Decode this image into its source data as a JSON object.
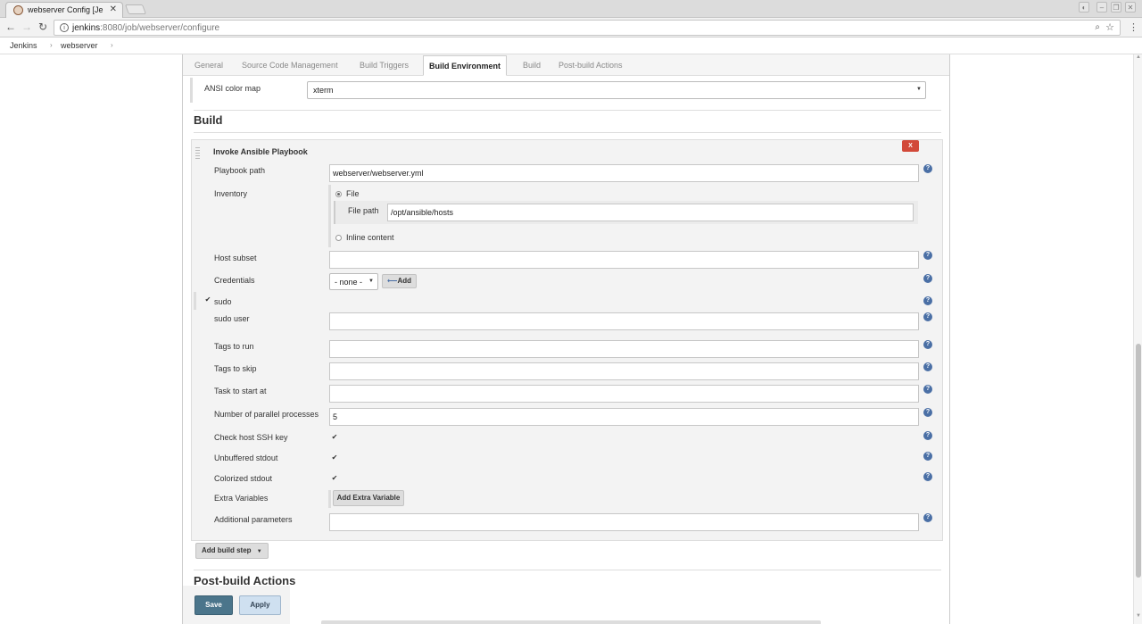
{
  "browser": {
    "tab_title": "webserver Config [Je",
    "tab_close": "✕",
    "url_host": "jenkins",
    "url_rest": ":8080/job/webserver/configure"
  },
  "breadcrumbs": [
    "Jenkins",
    "webserver"
  ],
  "tabs": [
    "General",
    "Source Code Management",
    "Build Triggers",
    "Build Environment",
    "Build",
    "Post-build Actions"
  ],
  "active_tab": "Build Environment",
  "ansi": {
    "label": "ANSI color map",
    "value": "xterm"
  },
  "build": {
    "title": "Build",
    "step_title": "Invoke Ansible Playbook",
    "delete_label": "X",
    "playbook_label": "Playbook path",
    "playbook_value": "webserver/webserver.yml",
    "inventory_label": "Inventory",
    "inventory_file_label": "File",
    "file_path_label": "File path",
    "file_path_value": "/opt/ansible/hosts",
    "inline_label": "Inline content",
    "host_subset_label": "Host subset",
    "credentials_label": "Credentials",
    "credentials_value": "- none -",
    "add_label": "Add",
    "sudo_label": "sudo",
    "sudo_user_label": "sudo user",
    "tags_run_label": "Tags to run",
    "tags_skip_label": "Tags to skip",
    "task_start_label": "Task to start at",
    "parallel_label": "Number of parallel processes",
    "parallel_value": "5",
    "check_ssh_label": "Check host SSH key",
    "unbuffered_label": "Unbuffered stdout",
    "colorized_label": "Colorized stdout",
    "extra_vars_label": "Extra Variables",
    "add_extra_var_label": "Add Extra Variable",
    "additional_params_label": "Additional parameters",
    "add_build_step_label": "Add build step"
  },
  "post_build_title": "Post-build Actions",
  "footer": {
    "save_label": "Save",
    "apply_label": "Apply"
  },
  "help_glyph": "?"
}
